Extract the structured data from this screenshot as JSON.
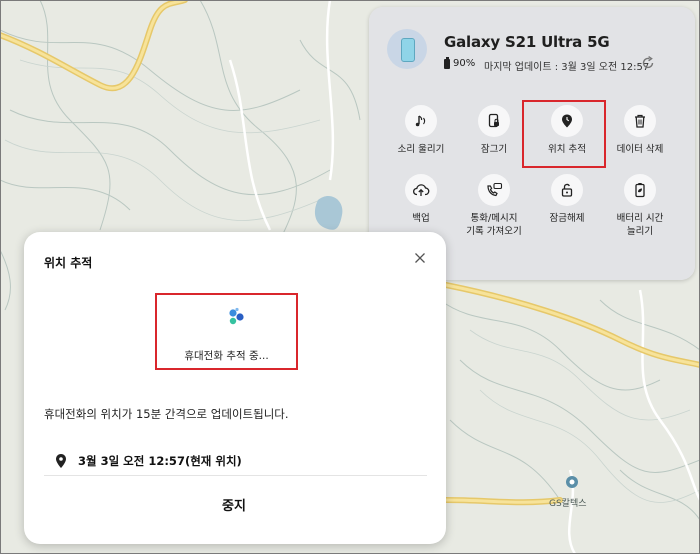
{
  "device": {
    "name": "Galaxy S21 Ultra 5G",
    "battery": "90%",
    "last_update": "마지막 업데이트 : 3월 3일 오전 12:57"
  },
  "actions": [
    {
      "label": "소리 울리기",
      "icon": "music-note-icon"
    },
    {
      "label": "잠그기",
      "icon": "lock-phone-icon"
    },
    {
      "label": "위치 추적",
      "icon": "location-pin-icon"
    },
    {
      "label": "데이터 삭제",
      "icon": "trash-icon"
    },
    {
      "label": "백업",
      "icon": "cloud-upload-icon"
    },
    {
      "label": "통화/메시지\n기록 가져오기",
      "icon": "call-message-icon"
    },
    {
      "label": "잠금해제",
      "icon": "unlock-icon"
    },
    {
      "label": "배터리 시간\n늘리기",
      "icon": "battery-saver-icon"
    }
  ],
  "dialog": {
    "title": "위치 추적",
    "tracking_text": "휴대전화 추적 중...",
    "notice": "휴대전화의 위치가 15분 간격으로 업데이트됩니다.",
    "location_time": "3월 3일 오전 12:57(현재 위치)",
    "stop_label": "중지"
  },
  "map": {
    "poi": "GS칼텍스"
  },
  "colors": {
    "highlight": "#d9262c",
    "road": "#f2d67a",
    "map_bg": "#e9ebe4"
  }
}
